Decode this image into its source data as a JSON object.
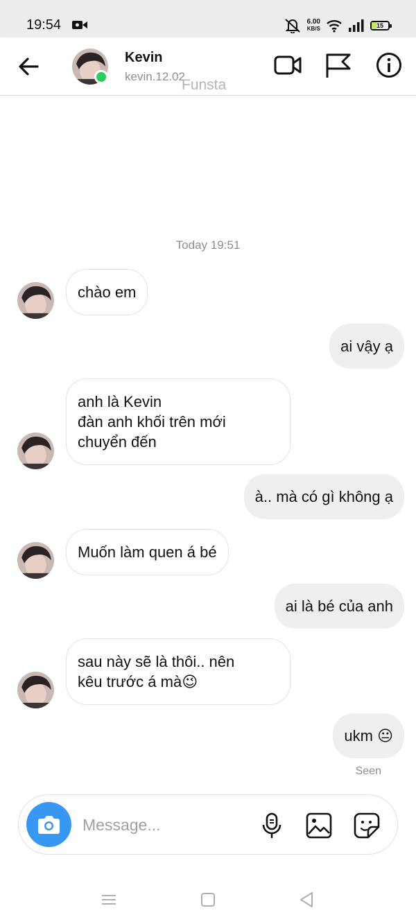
{
  "status_bar": {
    "time": "19:54",
    "net_speed": "6.00",
    "net_unit": "KB/S",
    "battery": "15"
  },
  "header": {
    "name": "Kevin",
    "username": "kevin.12.02",
    "watermark": "Funsta",
    "online_color": "#2ecc5b"
  },
  "chat": {
    "date": "Today 19:51",
    "messages": [
      {
        "side": "in",
        "text": "chào em"
      },
      {
        "side": "out",
        "text": "ai vậy ạ"
      },
      {
        "side": "in",
        "text": "anh là Kevin\nđàn anh khối trên mới\nchuyển đến"
      },
      {
        "side": "out",
        "text": "à.. mà có gì không ạ"
      },
      {
        "side": "in",
        "text": "Muốn làm quen á bé"
      },
      {
        "side": "out",
        "text": "ai là bé của anh"
      },
      {
        "side": "in",
        "text": "sau này sẽ là thôi.. nên\nkêu trước á mà😉"
      },
      {
        "side": "out",
        "text": "ukm 😐"
      }
    ],
    "seen": "Seen"
  },
  "composer": {
    "placeholder": "Message...",
    "camera_color": "#3897f0"
  },
  "icons": {
    "back": "arrow-left-icon",
    "video": "video-camera-icon",
    "flag": "flag-icon",
    "info": "info-icon",
    "camera": "camera-icon",
    "mic": "microphone-icon",
    "gallery": "image-icon",
    "sticker": "sticker-icon"
  }
}
